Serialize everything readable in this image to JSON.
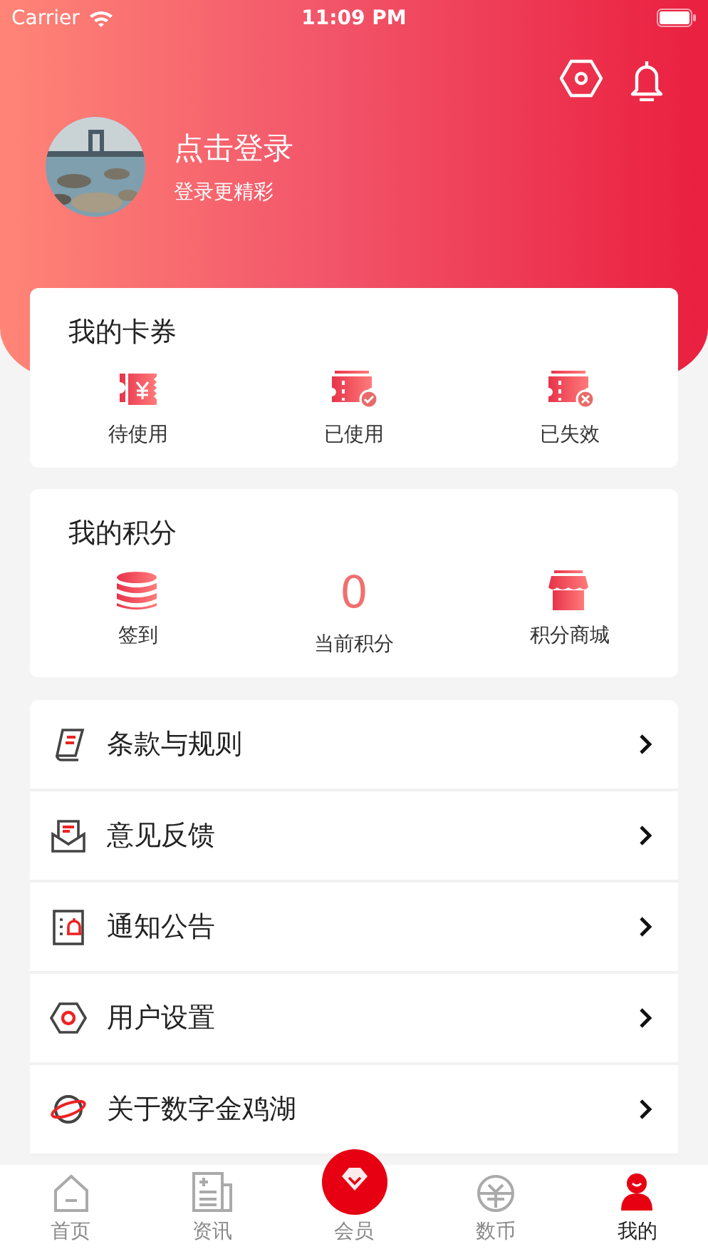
{
  "status_bar": {
    "carrier": "Carrier",
    "time": "11:09 PM"
  },
  "profile": {
    "title": "点击登录",
    "subtitle": "登录更精彩"
  },
  "coupons": {
    "title": "我的卡券",
    "items": [
      {
        "kind": "pending",
        "label": "待使用"
      },
      {
        "kind": "used",
        "label": "已使用"
      },
      {
        "kind": "expired",
        "label": "已失效"
      }
    ]
  },
  "points": {
    "title": "我的积分",
    "items": [
      {
        "kind": "checkin",
        "label": "签到"
      },
      {
        "kind": "value",
        "value": "0",
        "label": "当前积分"
      },
      {
        "kind": "shop",
        "label": "积分商城"
      }
    ]
  },
  "menu": [
    {
      "kind": "terms",
      "label": "条款与规则"
    },
    {
      "kind": "feedback",
      "label": "意见反馈"
    },
    {
      "kind": "notice",
      "label": "通知公告"
    },
    {
      "kind": "settings",
      "label": "用户设置"
    },
    {
      "kind": "about",
      "label": "关于数字金鸡湖"
    }
  ],
  "tab_bar": [
    {
      "kind": "home",
      "label": "首页",
      "selected": false
    },
    {
      "kind": "news",
      "label": "资讯",
      "selected": false
    },
    {
      "kind": "member",
      "label": "会员",
      "selected": false
    },
    {
      "kind": "coin",
      "label": "数币",
      "selected": false
    },
    {
      "kind": "me",
      "label": "我的",
      "selected": true
    }
  ]
}
